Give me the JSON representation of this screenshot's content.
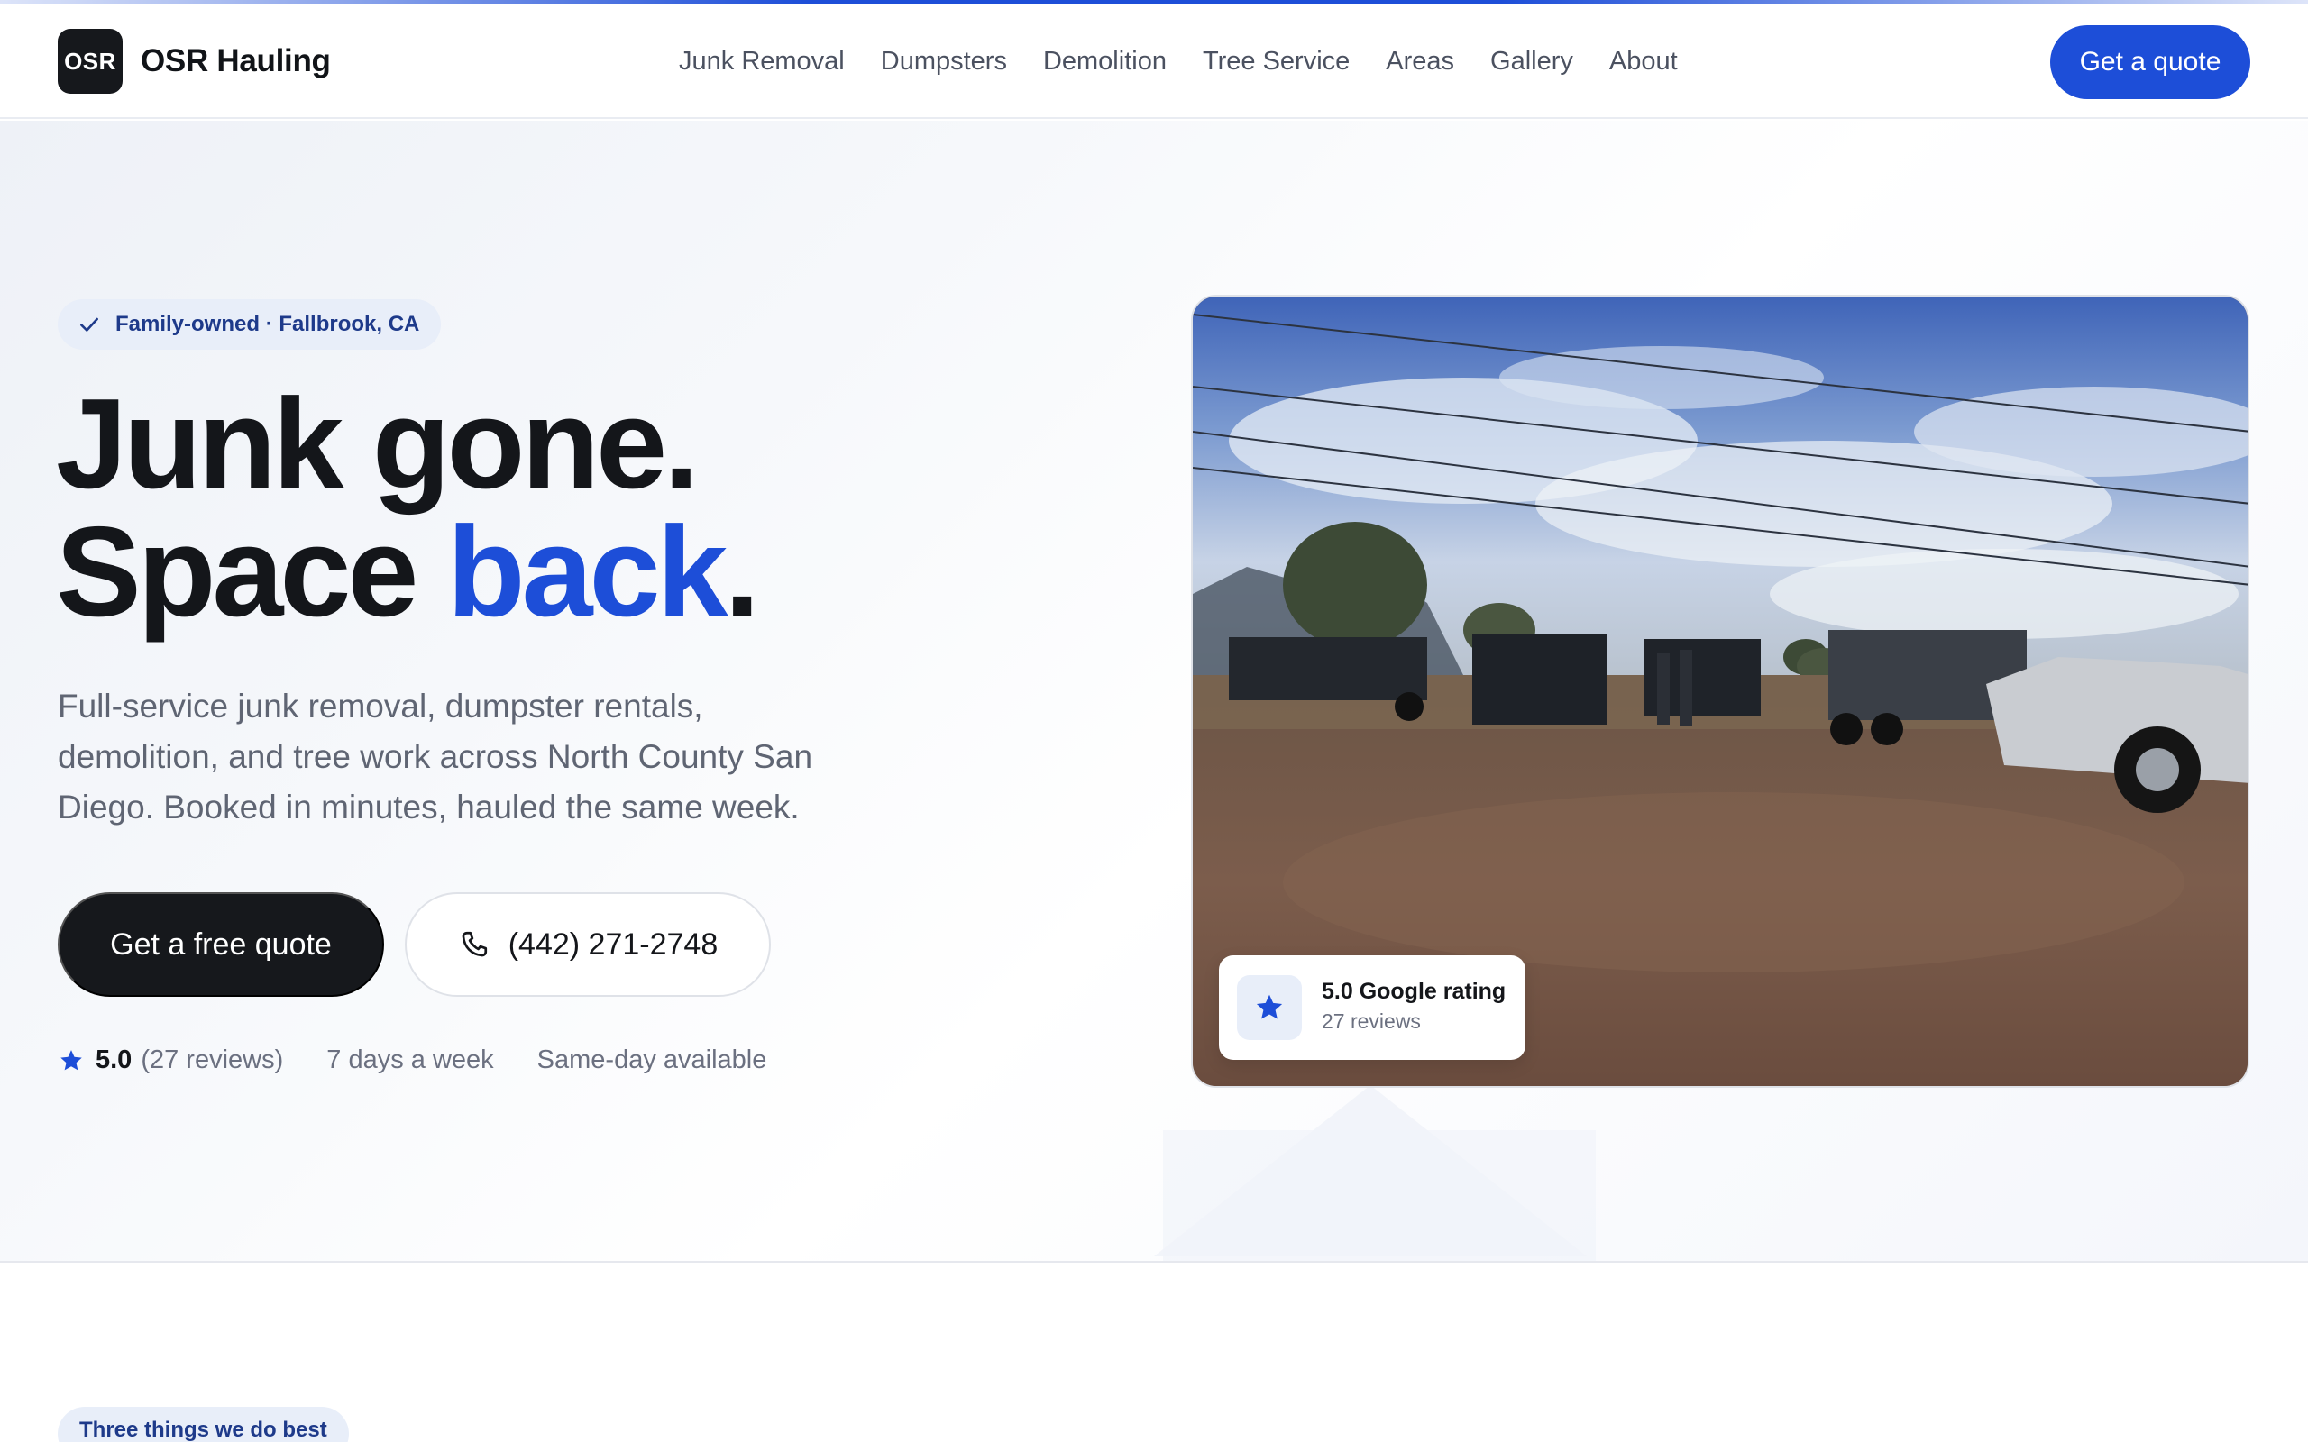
{
  "header": {
    "logo_mark": "OSR",
    "brand_name": "OSR Hauling",
    "nav": [
      {
        "label": "Junk Removal"
      },
      {
        "label": "Dumpsters"
      },
      {
        "label": "Demolition"
      },
      {
        "label": "Tree Service"
      },
      {
        "label": "Areas"
      },
      {
        "label": "Gallery"
      },
      {
        "label": "About"
      }
    ],
    "cta_label": "Get a quote"
  },
  "hero": {
    "badge_icon": "check-icon",
    "badge_text": "Family-owned · Fallbrook, CA",
    "headline_line1": "Junk gone.",
    "headline_line2_start": "Space ",
    "headline_line2_accent": "back",
    "headline_line2_end": ".",
    "subtitle": "Full-service junk removal, dumpster rentals, demolition, and tree work across North County San Diego. Booked in minutes, hauled the same week.",
    "primary_cta": "Get a free quote",
    "phone_icon": "phone-icon",
    "phone_cta": "(442) 271-2748",
    "meta": {
      "star_icon": "star-icon",
      "rating": "5.0",
      "reviews": "(27 reviews)",
      "days": "7 days a week",
      "same_day": "Same-day available"
    },
    "rating_card": {
      "icon": "star-icon",
      "title": "5.0 Google rating",
      "subtitle": "27 reviews"
    }
  },
  "next_section": {
    "badge_text": "Three things we do best"
  },
  "colors": {
    "accent": "#1d4ed8",
    "dark": "#16181c",
    "badge_bg": "#e8eef9"
  }
}
